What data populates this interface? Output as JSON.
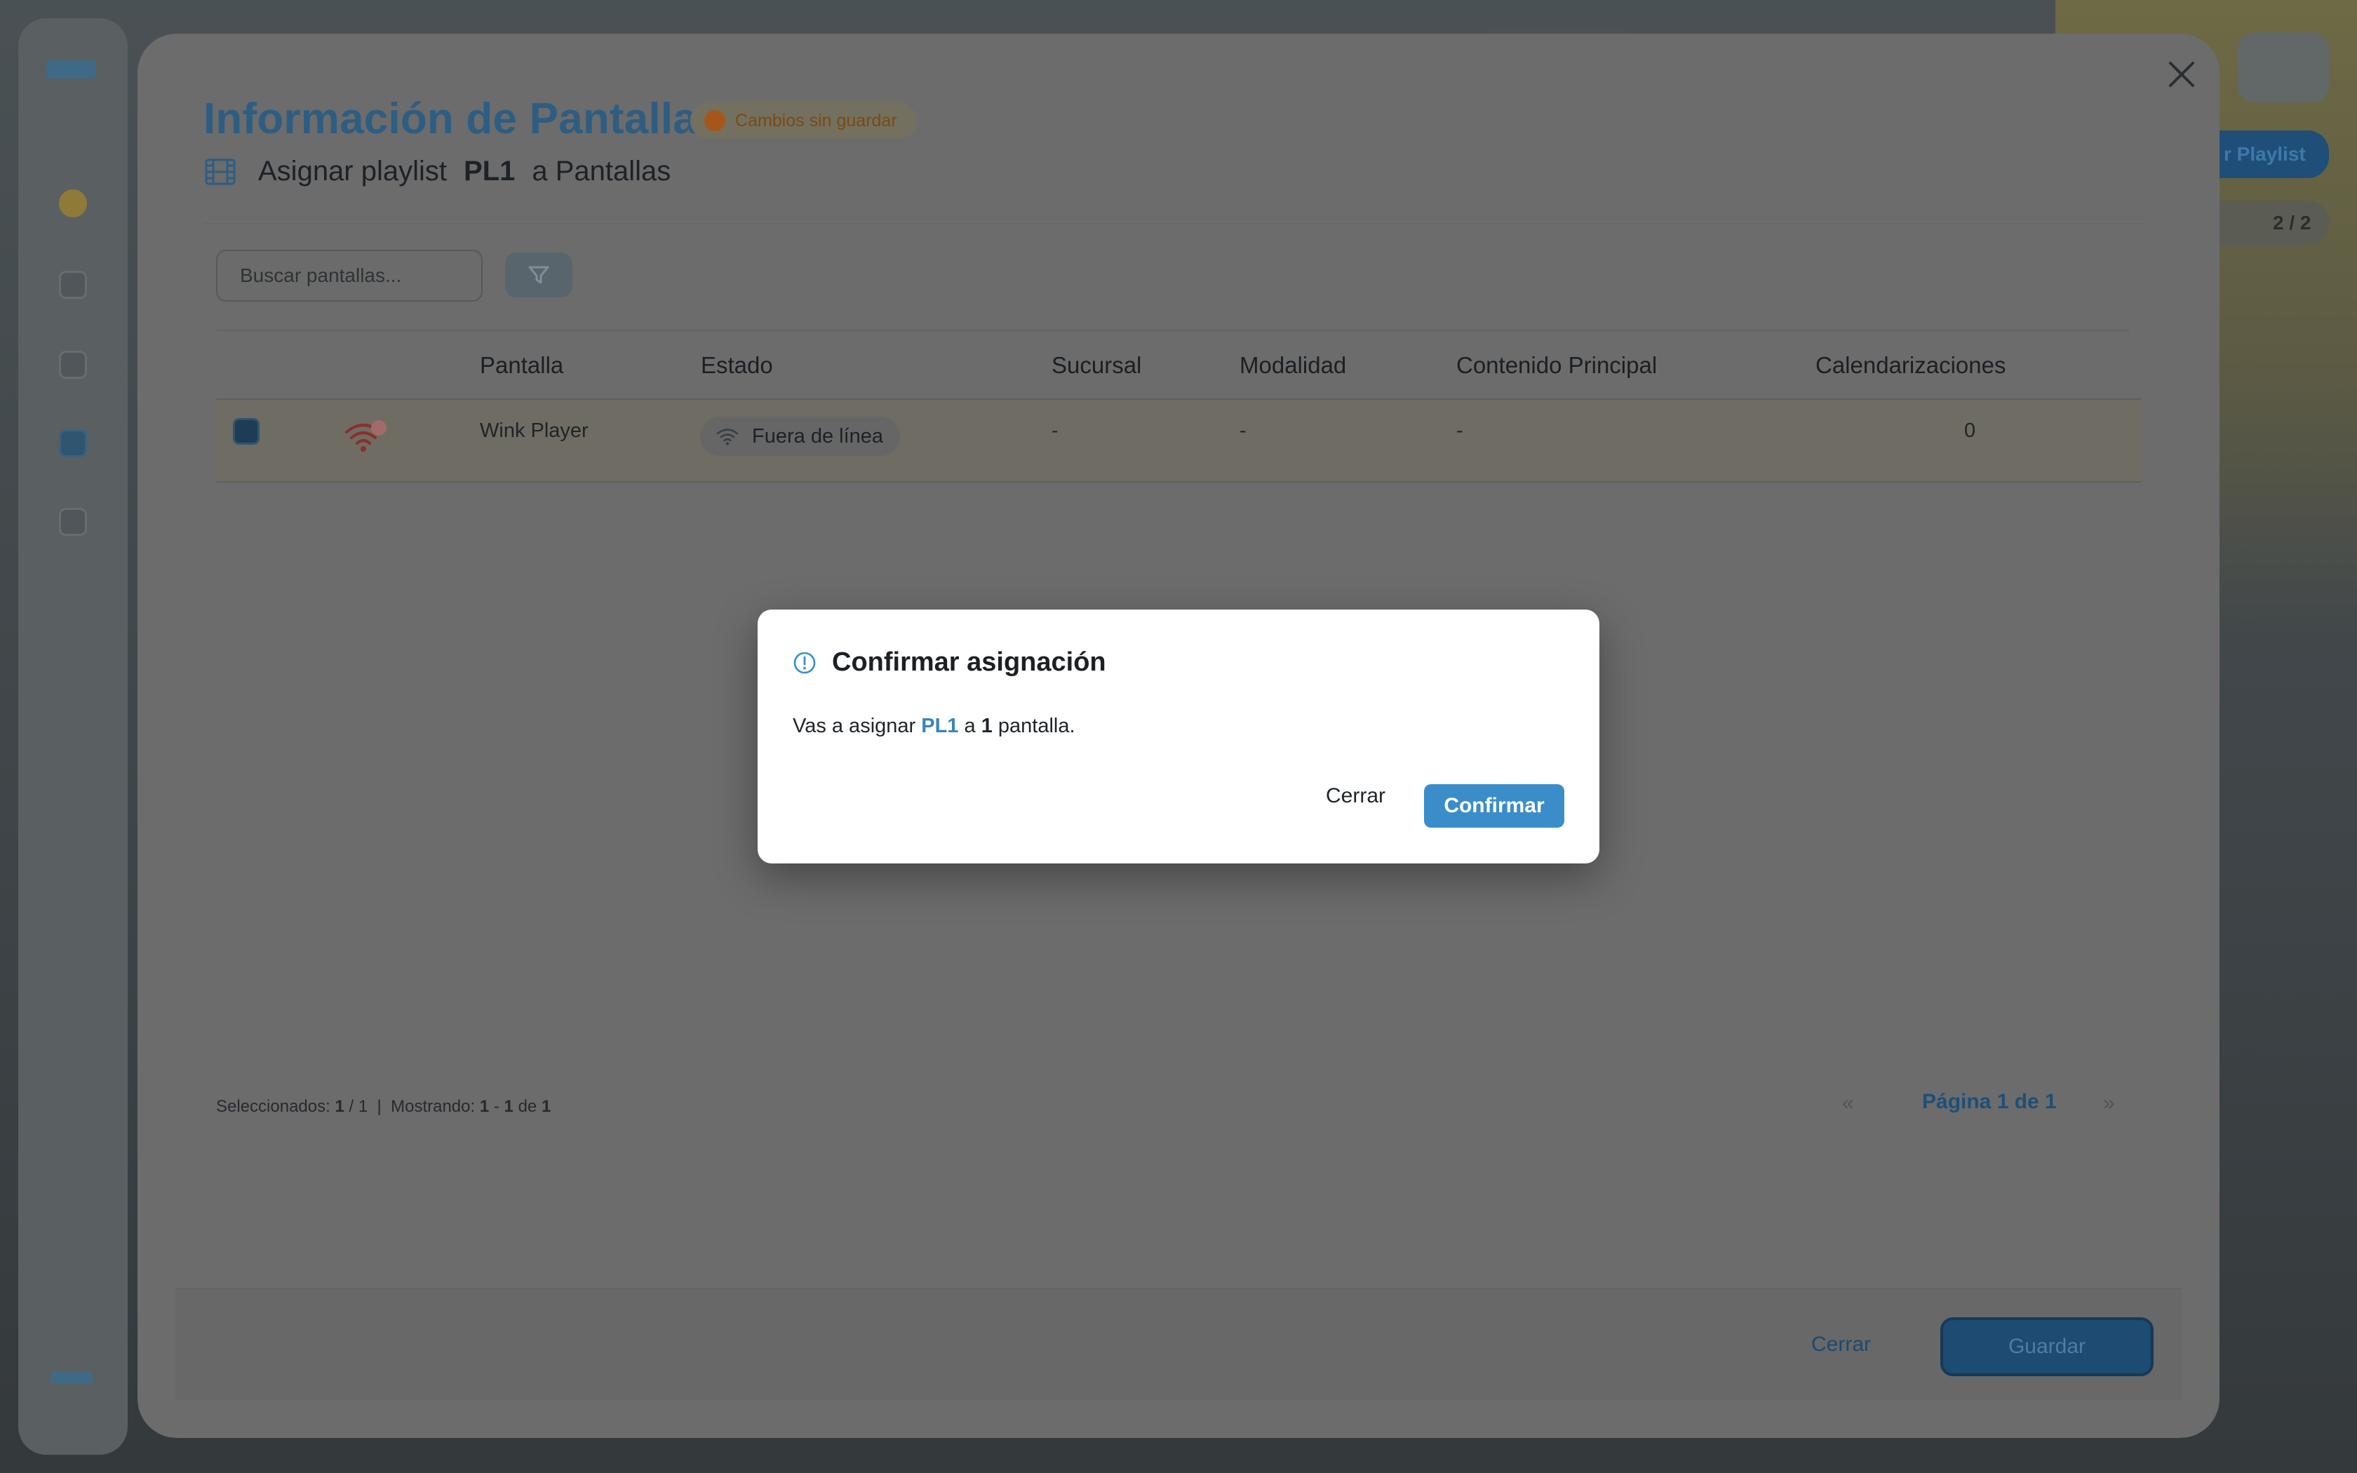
{
  "background": {
    "action_button_label": "r Playlist",
    "counter_label": "2 / 2"
  },
  "modal": {
    "title": "Información de Pantallas",
    "unsaved_badge": "Cambios sin guardar",
    "subtitle_prefix": "Asignar playlist",
    "playlist_name": "PL1",
    "subtitle_suffix": "a Pantallas",
    "search_placeholder": "Buscar pantallas...",
    "table": {
      "headers": [
        "Pantalla",
        "Estado",
        "Sucursal",
        "Modalidad",
        "Contenido Principal",
        "Calendarizaciones"
      ],
      "rows": [
        {
          "pantalla": "Wink Player",
          "estado": "Fuera de línea",
          "sucursal": "-",
          "modalidad": "-",
          "contenido_principal": "-",
          "calendarizaciones": "0"
        }
      ]
    },
    "footer_info": {
      "selected_label": "Seleccionados:",
      "selected": "1",
      "selected_sep": "/",
      "total": "1",
      "divider": "|",
      "showing_label": "Mostrando:",
      "range_start": "1",
      "range_dash": "-",
      "range_end": "1",
      "of_label": "de",
      "of_total": "1"
    },
    "pagination": {
      "prev_icon": "«",
      "label": "Página 1 de 1",
      "next_icon": "»"
    },
    "footer_buttons": {
      "close": "Cerrar",
      "save": "Guardar"
    }
  },
  "confirm": {
    "title": "Confirmar asignación",
    "msg_prefix": "Vas a asignar",
    "playlist": "PL1",
    "msg_mid": "a",
    "count": "1",
    "msg_suffix": "pantalla.",
    "cancel": "Cerrar",
    "ok": "Confirmar"
  },
  "colors": {
    "accent": "#3b8dc9",
    "title": "#2e5d82",
    "unsaved": "#a5571a"
  }
}
